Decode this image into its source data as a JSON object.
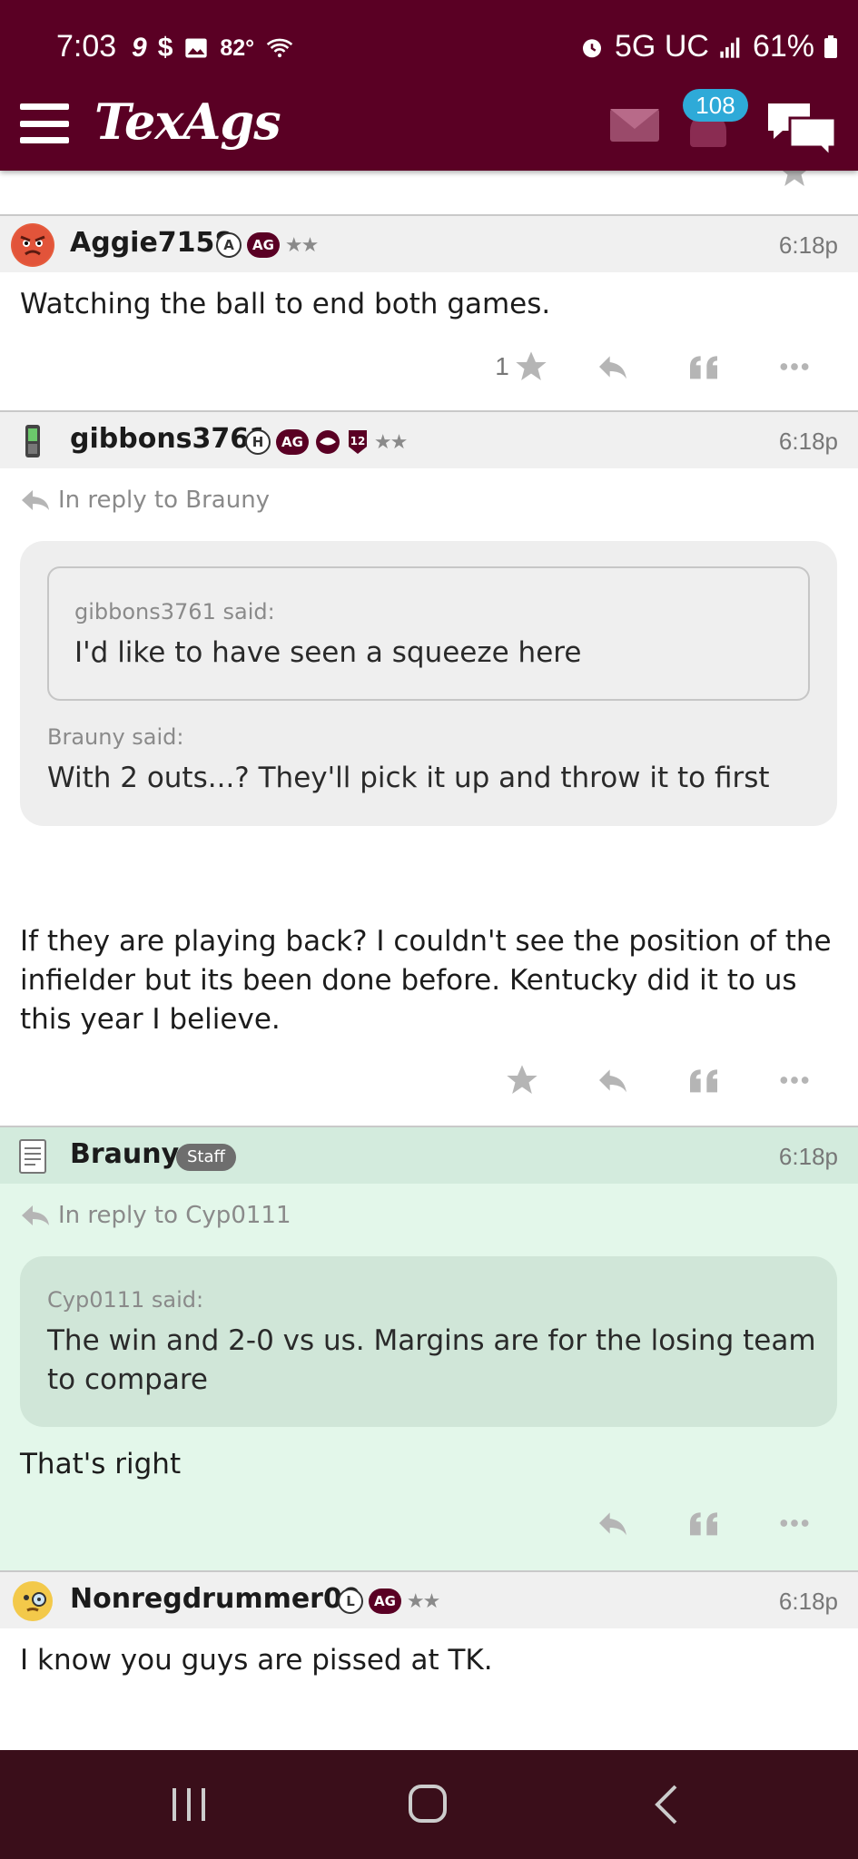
{
  "status_bar": {
    "time": "7:03",
    "temperature": "82°",
    "network": "5G UC",
    "battery": "61%"
  },
  "header": {
    "logo": "TexAgs",
    "notification_count": "108",
    "icons": [
      "menu-icon",
      "mail-icon",
      "bell-icon",
      "chat-icon"
    ]
  },
  "posts": [
    {
      "username": "Aggie7158",
      "tags": [
        "A",
        "AG"
      ],
      "stars": "★★",
      "time": "6:18p",
      "body": "Watching the ball to end both games.",
      "star_count": "1"
    },
    {
      "username": "gibbons3761",
      "tags": [
        "H",
        "AG"
      ],
      "stars": "★★",
      "time": "6:18p",
      "reply_to": "In reply to Brauny",
      "inner_quote_said": "gibbons3761 said:",
      "inner_quote_text": "I'd like to have seen a squeeze here",
      "outer_quote_said": "Brauny said:",
      "outer_quote_text": "With 2 outs...? They'll pick it up and throw it to first",
      "body": "If they are playing back? I couldn't see the position of the infielder but its been done before. Kentucky did it to us this year I believe."
    },
    {
      "username": "Brauny",
      "staff_label": "Staff",
      "time": "6:18p",
      "reply_to": "In reply to Cyp0111",
      "quote_said": "Cyp0111 said:",
      "quote_text": "The win and 2-0 vs us. Margins are for the losing team to compare",
      "body": "That's right"
    },
    {
      "username": "Nonregdrummer09",
      "tags": [
        "L",
        "AG"
      ],
      "stars": "★★",
      "time": "6:18p",
      "body": "I know you guys are pissed at TK."
    }
  ],
  "colors": {
    "maroon": "#5a0024",
    "badge_blue": "#2eaad8",
    "staff_green": "#e3f7ea",
    "nav_bar": "#3a0e1a"
  }
}
